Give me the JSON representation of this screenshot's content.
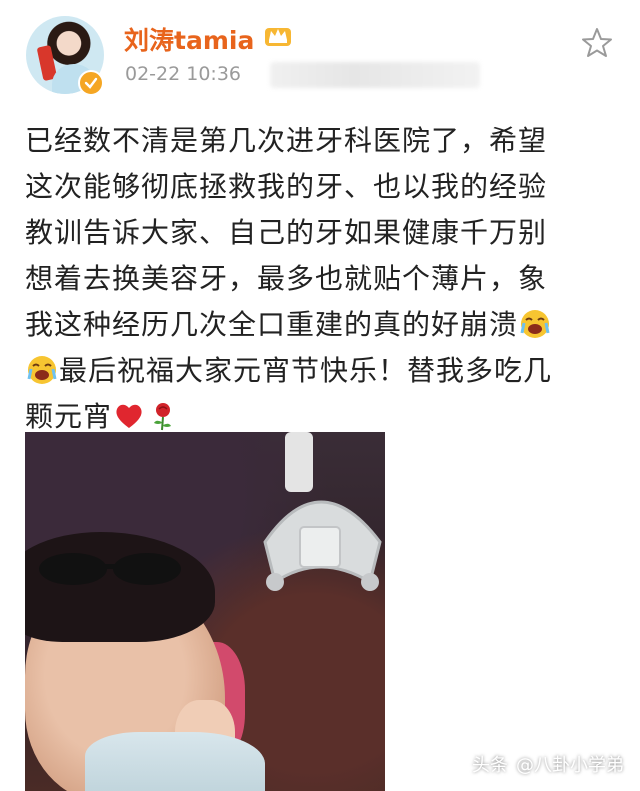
{
  "post": {
    "username": "刘涛tamia",
    "timestamp": "02-22 10:36",
    "lines": [
      "已经数不清是第几次进牙科医院了，希望",
      "这次能够彻底拯救我的牙、也以我的经验",
      "教训告诉大家、自己的牙如果健康千万别",
      "想着去换美容牙，最多也就贴个薄片，象",
      "我这种经历几次全口重建的真的好崩溃",
      "最后祝福大家元宵节快乐！替我多吃几",
      "颗元宵"
    ],
    "icons": {
      "verify": "verified-badge-icon",
      "crown": "vip-crown-icon",
      "star": "star-icon",
      "emoji_cry": "crying-emoji-icon",
      "heart": "heart-icon",
      "rose": "rose-icon"
    }
  },
  "watermark": {
    "brand": "头条",
    "handle": "@八卦小学弟"
  },
  "colors": {
    "username": "#e8641c",
    "timestamp": "#9a9a9a",
    "text": "#222222",
    "badge": "#f5a623",
    "heart": "#e0262f"
  }
}
